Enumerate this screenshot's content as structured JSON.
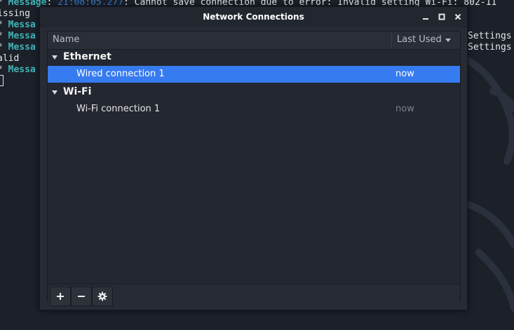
{
  "terminal": {
    "lines": [
      {
        "prefix": "* ",
        "label": "Message",
        "sep": ": ",
        "time": "21:08:05.277",
        "text": ": Cannot save connection due to error: Invalid setting Wi-Fi: 802-11"
      },
      {
        "prefix": "",
        "label": "",
        "sep": "",
        "time": "",
        "text": "issing"
      },
      {
        "prefix": "* ",
        "label": "Messa",
        "sep": "",
        "time": "",
        "text": ""
      },
      {
        "prefix": "* ",
        "label": "Messa",
        "sep": "",
        "time": "",
        "text": ""
      },
      {
        "prefix": "* ",
        "label": "Messa",
        "sep": "",
        "time": "",
        "text": ""
      },
      {
        "prefix": "",
        "label": "",
        "sep": "",
        "time": "",
        "text": "alid"
      },
      {
        "prefix": "* ",
        "label": "Messa",
        "sep": "",
        "time": "",
        "text": ""
      }
    ],
    "right_fragments": [
      "Settings",
      "Settings"
    ]
  },
  "window": {
    "title": "Network Connections",
    "buttons": {
      "minimize": "minimize",
      "maximize": "maximize",
      "close": "close"
    }
  },
  "list": {
    "headers": {
      "name": "Name",
      "last_used": "Last Used"
    },
    "groups": [
      {
        "label": "Ethernet",
        "connections": [
          {
            "name": "Wired connection 1",
            "last_used": "now",
            "selected": true
          }
        ]
      },
      {
        "label": "Wi-Fi",
        "connections": [
          {
            "name": "Wi-Fi connection 1",
            "last_used": "now",
            "selected": false
          }
        ]
      }
    ]
  },
  "toolbar": {
    "add_icon": "plus-icon",
    "remove_icon": "minus-icon",
    "settings_icon": "gear-icon"
  },
  "colors": {
    "selection": "#367bf0",
    "terminal_label": "#3fb5b8",
    "terminal_timestamp": "#3a7ad0"
  }
}
